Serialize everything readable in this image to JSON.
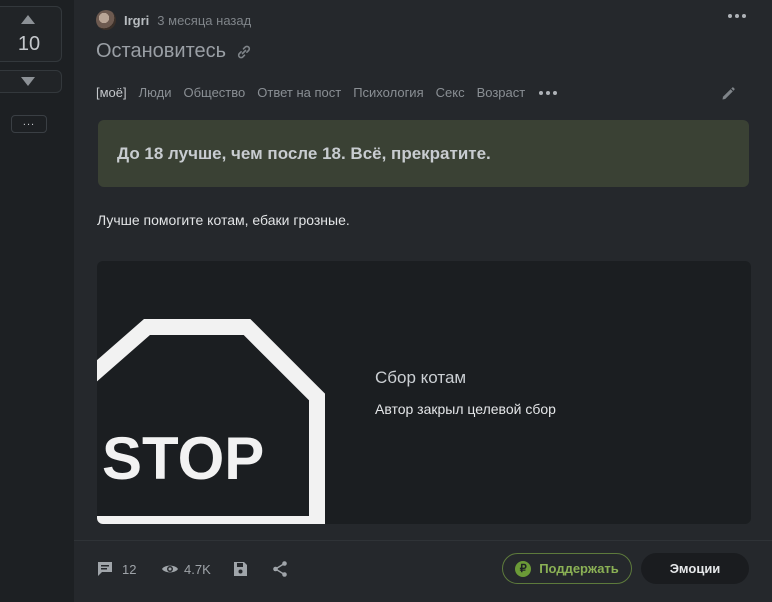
{
  "vote": {
    "count": "10",
    "more_label": "..."
  },
  "post": {
    "author": "Irgri",
    "time": "3 месяца назад",
    "title": "Остановитесь",
    "tags": [
      "[моё]",
      "Люди",
      "Общество",
      "Ответ на пост",
      "Психология",
      "Секс",
      "Возраст"
    ],
    "quote": "До 18 лучше, чем после 18. Всё, прекратите.",
    "text": "Лучше помогите котам, ебаки грозные.",
    "donation": {
      "image_text": "STOP",
      "title": "Сбор котам",
      "subtitle": "Автор закрыл целевой сбор"
    }
  },
  "footer": {
    "comments": "12",
    "views": "4.7K",
    "support_label": "Поддержать",
    "support_icon": "₽",
    "emotions_label": "Эмоции"
  },
  "colors": {
    "background": "#1f2225",
    "card": "#25282c",
    "quote_bg": "#3a4134",
    "accent_green": "#8bb155"
  },
  "icons": [
    "chevron-up-icon",
    "chevron-down-icon",
    "more-dots-icon",
    "link-icon",
    "edit-pencil-icon",
    "comment-icon",
    "eye-icon",
    "save-icon",
    "share-icon",
    "ruble-icon"
  ]
}
